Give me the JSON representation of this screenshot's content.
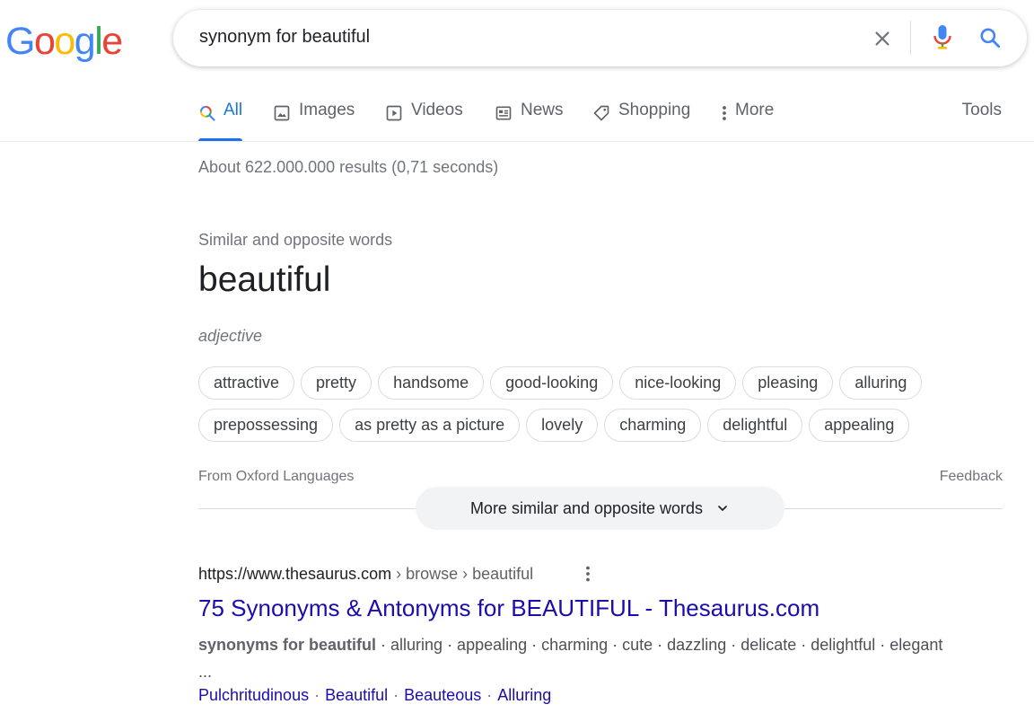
{
  "logo": {
    "letters": [
      "G",
      "o",
      "o",
      "g",
      "l",
      "e"
    ],
    "colors": [
      "#4285f4",
      "#ea4335",
      "#fbbc05",
      "#4285f4",
      "#34a853",
      "#ea4335"
    ]
  },
  "search": {
    "query": "synonym for beautiful",
    "icons": {
      "clear": "close-icon",
      "voice": "microphone-icon",
      "submit": "search-icon"
    }
  },
  "tabs": [
    {
      "label": "All",
      "icon": "search-icon",
      "active": true
    },
    {
      "label": "Images",
      "icon": "image-icon"
    },
    {
      "label": "Videos",
      "icon": "play-icon"
    },
    {
      "label": "News",
      "icon": "newspaper-icon"
    },
    {
      "label": "Shopping",
      "icon": "tag-icon"
    },
    {
      "label": "More",
      "icon": "more-vert-icon"
    }
  ],
  "tools_label": "Tools",
  "result_stats": "About 622.000.000 results (0,71 seconds)",
  "dictionary": {
    "section_title": "Similar and opposite words",
    "headword": "beautiful",
    "part_of_speech": "adjective",
    "synonyms_row1": [
      "attractive",
      "pretty",
      "handsome",
      "good-looking",
      "nice-looking",
      "pleasing",
      "alluring"
    ],
    "synonyms_row2": [
      "prepossessing",
      "as pretty as a picture",
      "lovely",
      "charming",
      "delightful",
      "appealing"
    ],
    "source": "From Oxford Languages",
    "feedback": "Feedback",
    "more_button": "More similar and opposite words"
  },
  "result": {
    "url_base": "https://www.thesaurus.com",
    "url_crumbs": " › browse › beautiful",
    "title": "75 Synonyms & Antonyms for BEAUTIFUL - Thesaurus.com",
    "snippet_bold": "synonyms for beautiful",
    "snippet_rest": " · alluring · appealing · charming · cute · dazzling · delicate · delightful · elegant ...",
    "sitelinks": [
      "Pulchritudinous",
      "Beautiful",
      "Beauteous",
      "Alluring"
    ]
  },
  "colors": {
    "accent": "#1a73e8",
    "link": "#1a0dab",
    "secondary_text": "#70757a"
  }
}
